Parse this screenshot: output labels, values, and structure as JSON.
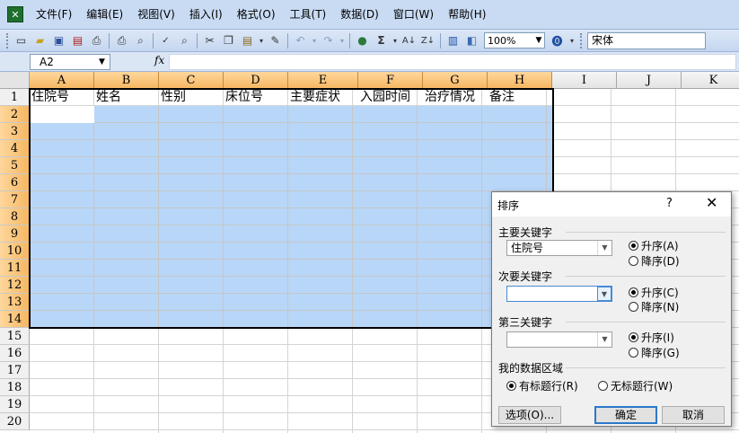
{
  "menubar": {
    "app_icon": "excel-icon",
    "items": [
      "文件(F)",
      "编辑(E)",
      "视图(V)",
      "插入(I)",
      "格式(O)",
      "工具(T)",
      "数据(D)",
      "窗口(W)",
      "帮助(H)"
    ]
  },
  "toolbar": {
    "zoom": "100%",
    "font": "宋体",
    "icons": [
      "new-icon",
      "open-icon",
      "save-icon",
      "permission-icon",
      "print-icon",
      "print-preview-icon",
      "spelling-icon",
      "research-icon",
      "cut-icon",
      "copy-icon",
      "paste-icon",
      "format-painter-icon",
      "undo-icon",
      "redo-icon",
      "hyperlink-icon",
      "autosum-icon",
      "sort-ascending-icon",
      "sort-descending-icon",
      "chart-wizard-icon",
      "drawing-icon",
      "help-icon"
    ]
  },
  "formula_bar": {
    "name_box": "A2",
    "fx": "fx",
    "content": ""
  },
  "sheet": {
    "columns": [
      "A",
      "B",
      "C",
      "D",
      "E",
      "F",
      "G",
      "H",
      "I",
      "J",
      "K"
    ],
    "rows": [
      "1",
      "2",
      "3",
      "4",
      "5",
      "6",
      "7",
      "8",
      "9",
      "10",
      "11",
      "12",
      "13",
      "14",
      "15",
      "16",
      "17",
      "18",
      "19",
      "20"
    ],
    "header_row": [
      "住院号",
      "姓名",
      "性别",
      "床位号",
      "主要症状",
      "入园时间",
      "治疗情况",
      "备注"
    ]
  },
  "sort_dialog": {
    "title": "排序",
    "help": "?",
    "close": "✕",
    "primary": {
      "label": "主要关键字",
      "value": "住院号",
      "asc": "升序(A)",
      "desc": "降序(D)",
      "selected": "asc"
    },
    "secondary": {
      "label": "次要关键字",
      "value": "",
      "asc": "升序(C)",
      "desc": "降序(N)",
      "selected": "asc"
    },
    "third": {
      "label": "第三关键字",
      "value": "",
      "asc": "升序(I)",
      "desc": "降序(G)",
      "selected": "asc"
    },
    "range": {
      "label": "我的数据区域",
      "has_header": "有标题行(R)",
      "no_header": "无标题行(W)",
      "selected": "has_header"
    },
    "buttons": {
      "options": "选项(O)...",
      "ok": "确定",
      "cancel": "取消"
    }
  }
}
